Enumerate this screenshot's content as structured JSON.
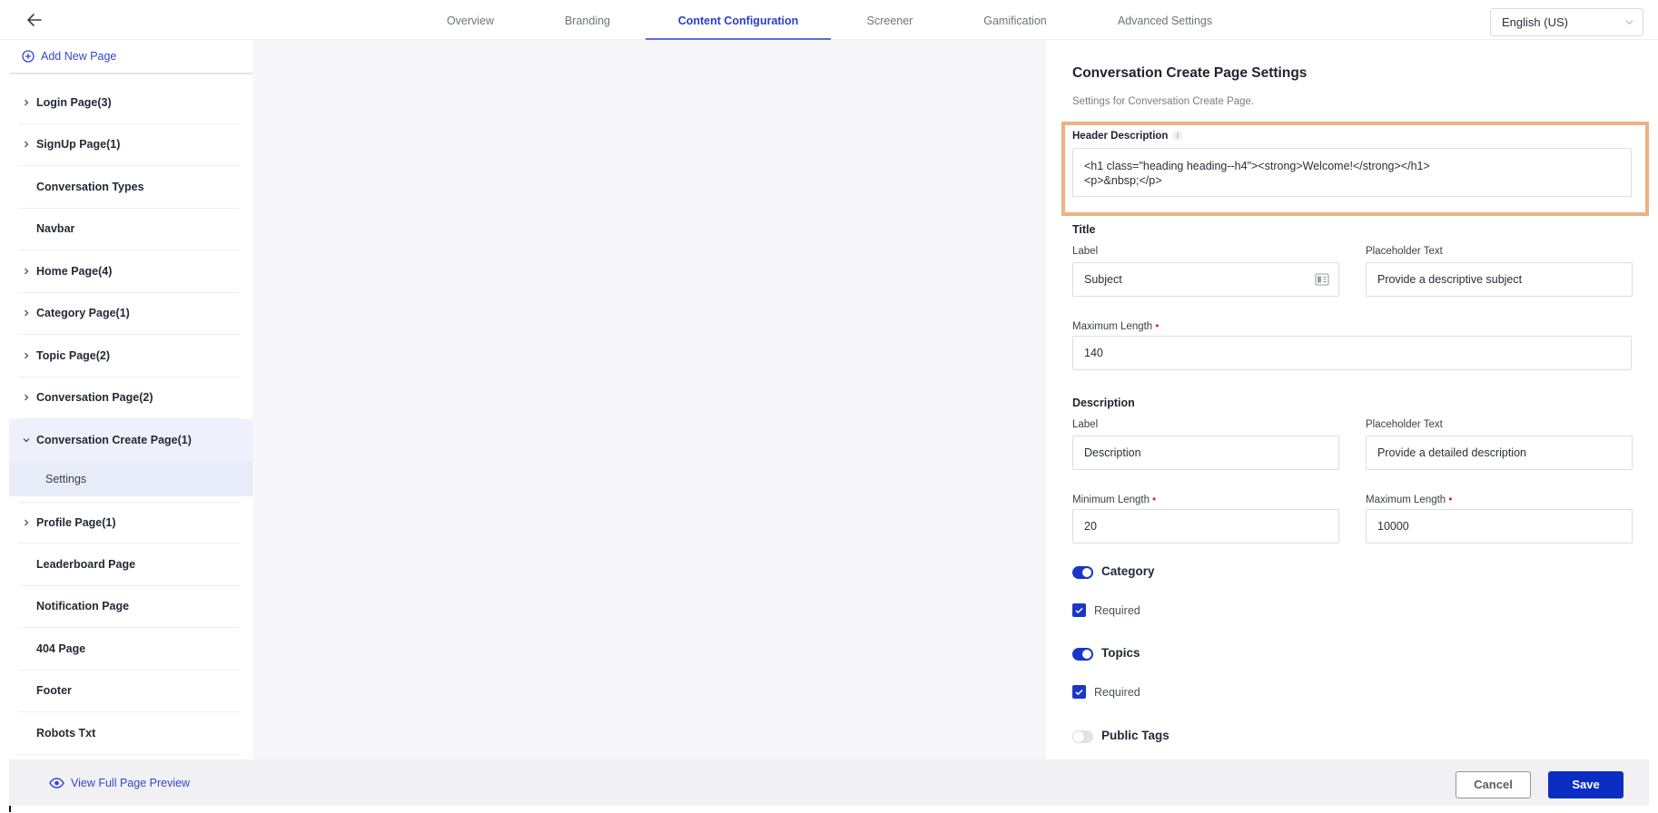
{
  "topnav": {
    "back_icon": "arrow-left-icon",
    "tabs": [
      {
        "label": "Overview",
        "active": false
      },
      {
        "label": "Branding",
        "active": false
      },
      {
        "label": "Content Configuration",
        "active": true
      },
      {
        "label": "Screener",
        "active": false
      },
      {
        "label": "Gamification",
        "active": false
      },
      {
        "label": "Advanced Settings",
        "active": false
      }
    ],
    "language": {
      "selected": "English (US)",
      "icon": "chevron-down-icon"
    }
  },
  "sidebar": {
    "add_page": {
      "label": "Add New Page",
      "icon": "plus-circle-icon"
    },
    "items": [
      {
        "label": "Login Page(3)",
        "expandable": true
      },
      {
        "label": "SignUp Page(1)",
        "expandable": true
      },
      {
        "label": "Conversation Types",
        "expandable": false
      },
      {
        "label": "Navbar",
        "expandable": false
      },
      {
        "label": "Home Page(4)",
        "expandable": true
      },
      {
        "label": "Category Page(1)",
        "expandable": true
      },
      {
        "label": "Topic Page(2)",
        "expandable": true
      },
      {
        "label": "Conversation Page(2)",
        "expandable": true
      },
      {
        "label": "Conversation Create Page(1)",
        "expandable": true,
        "expanded": true,
        "children": [
          {
            "label": "Settings",
            "selected": true
          }
        ]
      },
      {
        "label": "Profile Page(1)",
        "expandable": true
      },
      {
        "label": "Leaderboard Page",
        "expandable": false
      },
      {
        "label": "Notification Page",
        "expandable": false
      },
      {
        "label": "404 Page",
        "expandable": false
      },
      {
        "label": "Footer",
        "expandable": false
      },
      {
        "label": "Robots Txt",
        "expandable": false
      }
    ]
  },
  "panel": {
    "title": "Conversation Create Page Settings",
    "subtitle": "Settings for Conversation Create Page.",
    "header_description": {
      "label": "Header Description",
      "info_icon": "info-icon",
      "value": "<h1 class=\"heading heading--h4\"><strong>Welcome!</strong></h1>\n<p>&nbsp;</p>"
    },
    "title_section": {
      "heading": "Title",
      "label_field": {
        "label": "Label",
        "value": "Subject",
        "icon": "contact-card-icon"
      },
      "placeholder_field": {
        "label": "Placeholder Text",
        "value": "Provide a descriptive subject"
      },
      "max_length": {
        "label": "Maximum Length",
        "required": true,
        "value": "140"
      }
    },
    "description_section": {
      "heading": "Description",
      "label_field": {
        "label": "Label",
        "value": "Description"
      },
      "placeholder_field": {
        "label": "Placeholder Text",
        "value": "Provide a detailed description"
      },
      "min_length": {
        "label": "Minimum Length",
        "required": true,
        "value": "20"
      },
      "max_length": {
        "label": "Maximum Length",
        "required": true,
        "value": "10000"
      }
    },
    "toggles": [
      {
        "label": "Category",
        "on": true,
        "required_label": "Required",
        "required_checked": true
      },
      {
        "label": "Topics",
        "on": true,
        "required_label": "Required",
        "required_checked": true
      },
      {
        "label": "Public Tags",
        "on": false
      }
    ],
    "required_marker": "•"
  },
  "footer": {
    "preview_link": {
      "label": "View Full Page Preview",
      "icon": "eye-icon"
    },
    "cancel_label": "Cancel",
    "save_label": "Save"
  },
  "colors": {
    "accent": "#2b3fc9",
    "primary_button": "#0a2ec4",
    "highlight_border": "#ecb184",
    "required": "#d22d2d"
  }
}
